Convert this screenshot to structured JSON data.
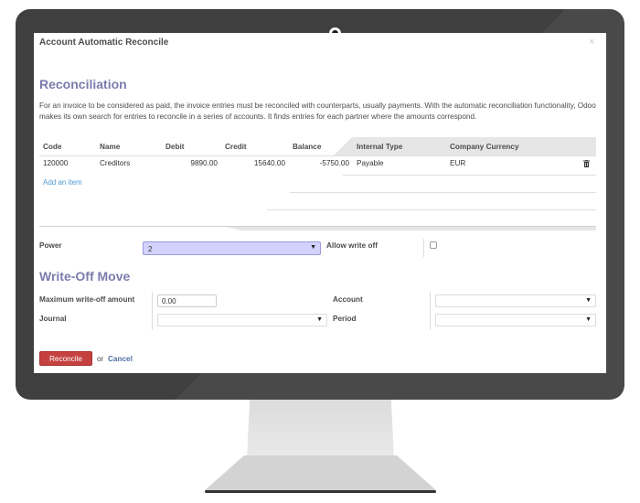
{
  "dialog": {
    "title": "Account Automatic Reconcile",
    "close_icon": "close-icon"
  },
  "reconciliation": {
    "section_title": "Reconciliation",
    "description": "For an invoice to be considered as paid, the invoice entries must be reconciled with counterparts, usually payments. With the automatic reconciliation functionality, Odoo makes its own search for entries to reconcile in a series of accounts. It finds entries for each partner where the amounts correspond.",
    "columns": [
      "Code",
      "Name",
      "Debit",
      "Credit",
      "Balance",
      "Internal Type",
      "Company Currency"
    ],
    "rows": [
      {
        "code": "120000",
        "name": "Creditors",
        "debit": "9890.00",
        "credit": "15640.00",
        "balance": "-5750.00",
        "internal_type": "Payable",
        "company_currency": "EUR"
      }
    ],
    "add_item_label": "Add an item",
    "delete_icon": "trash-icon"
  },
  "options": {
    "power_label": "Power",
    "power_value": "2",
    "allow_write_off_label": "Allow write off",
    "allow_write_off_checked": false
  },
  "write_off": {
    "section_title": "Write-Off Move",
    "max_amount_label": "Maximum write-off amount",
    "max_amount_value": "0.00",
    "journal_label": "Journal",
    "journal_value": "",
    "account_label": "Account",
    "account_value": "",
    "period_label": "Period",
    "period_value": ""
  },
  "footer": {
    "reconcile_label": "Reconcile",
    "or_text": "or",
    "cancel_label": "Cancel"
  },
  "colors": {
    "accent": "#7c7bad",
    "button": "#c4413f",
    "link": "#4c9ad2"
  }
}
